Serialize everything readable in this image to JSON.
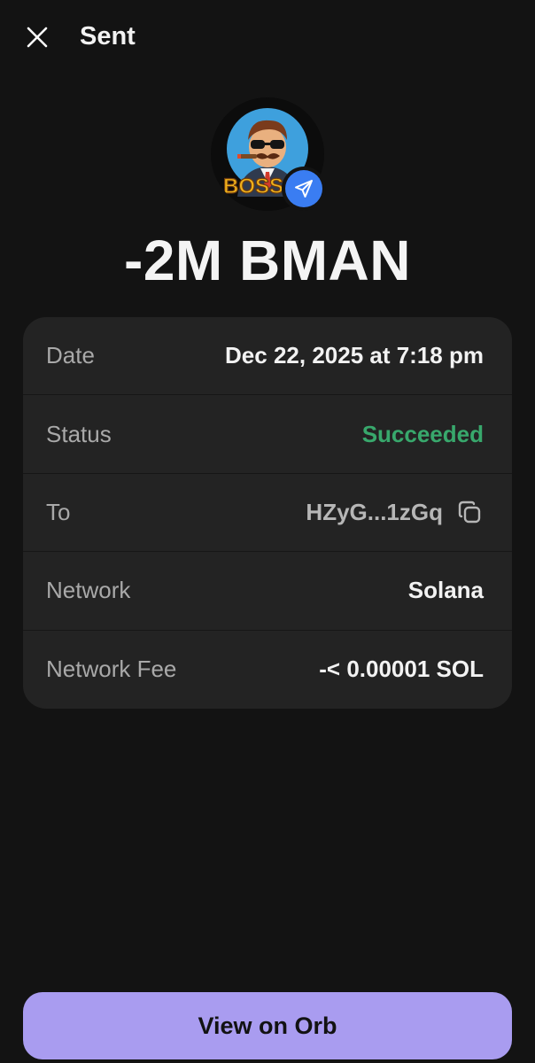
{
  "header": {
    "title": "Sent",
    "close_icon": "close-icon"
  },
  "token": {
    "avatar_icon": "bossman-token-logo",
    "avatar_text": "BOSSM",
    "badge_icon": "send-arrow-icon",
    "badge_color": "#3a7df2"
  },
  "amount": "-2M BMAN",
  "details": {
    "date": {
      "label": "Date",
      "value": "Dec 22, 2025 at 7:18 pm"
    },
    "status": {
      "label": "Status",
      "value": "Succeeded",
      "color": "#38a86c"
    },
    "to": {
      "label": "To",
      "value": "HZyG...1zGq",
      "copy_icon": "copy-icon"
    },
    "network": {
      "label": "Network",
      "value": "Solana"
    },
    "network_fee": {
      "label": "Network Fee",
      "value": "-< 0.00001 SOL"
    }
  },
  "cta": {
    "label": "View on Orb",
    "color": "#a99cf0"
  }
}
